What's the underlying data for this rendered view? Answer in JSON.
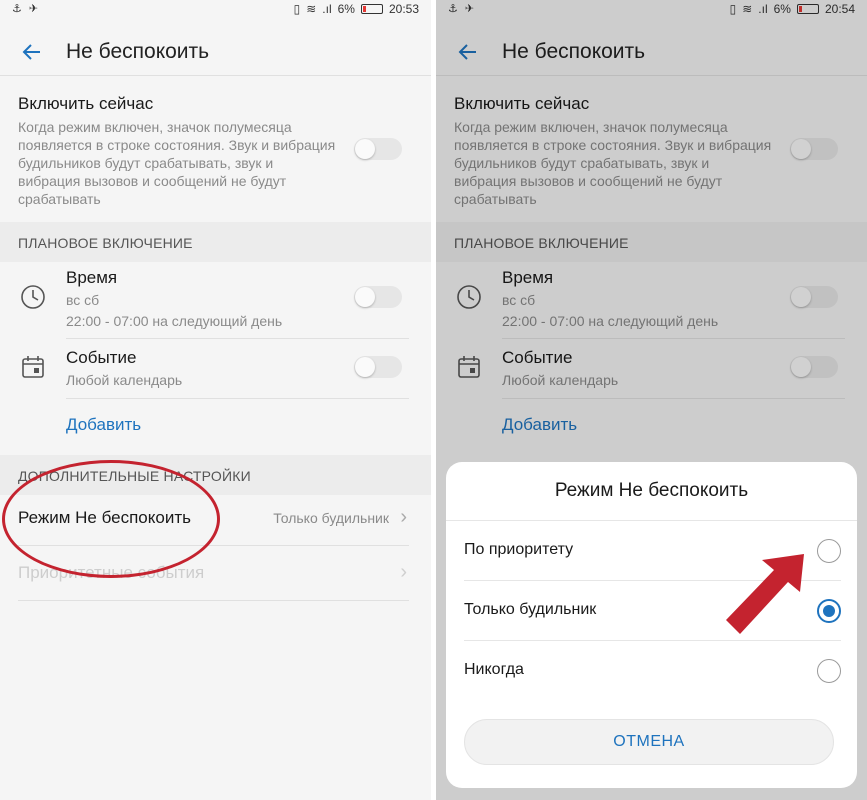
{
  "status_left": {
    "icons": "⚓ ✈",
    "time": "20:53"
  },
  "status_right": {
    "icons": "⚓ ✈",
    "time": "20:54"
  },
  "status_common": {
    "vibrate": "▯",
    "wifi": "≋",
    "signal": ".ıl",
    "battery": "6%"
  },
  "header": {
    "back_icon": "arrow-left-icon",
    "title": "Не беспокоить"
  },
  "enable_now": {
    "title": "Включить сейчас",
    "description": "Когда режим включен, значок полумесяца появляется в строке состояния. Звук и вибрация будильников будут срабатывать, звук и вибрация вызовов и сообщений не будут срабатывать"
  },
  "scheduled": {
    "header": "ПЛАНОВОЕ ВКЛЮЧЕНИЕ",
    "time": {
      "title": "Время",
      "days": "вс сб",
      "range": "22:00 - 07:00 на следующий день"
    },
    "event": {
      "title": "Событие",
      "calendar": "Любой календарь"
    },
    "add": "Добавить"
  },
  "additional": {
    "header": "ДОПОЛНИТЕЛЬНЫЕ НАСТРОЙКИ",
    "mode": {
      "title": "Режим Не беспокоить",
      "value": "Только будильник"
    },
    "priority": {
      "title": "Приоритетные события"
    }
  },
  "dialog": {
    "title": "Режим Не беспокоить",
    "options": [
      {
        "label": "По приоритету",
        "selected": false
      },
      {
        "label": "Только будильник",
        "selected": true
      },
      {
        "label": "Никогда",
        "selected": false
      }
    ],
    "cancel": "ОТМЕНА"
  },
  "colors": {
    "accent": "#1e73be",
    "annotation": "#c4232f"
  }
}
